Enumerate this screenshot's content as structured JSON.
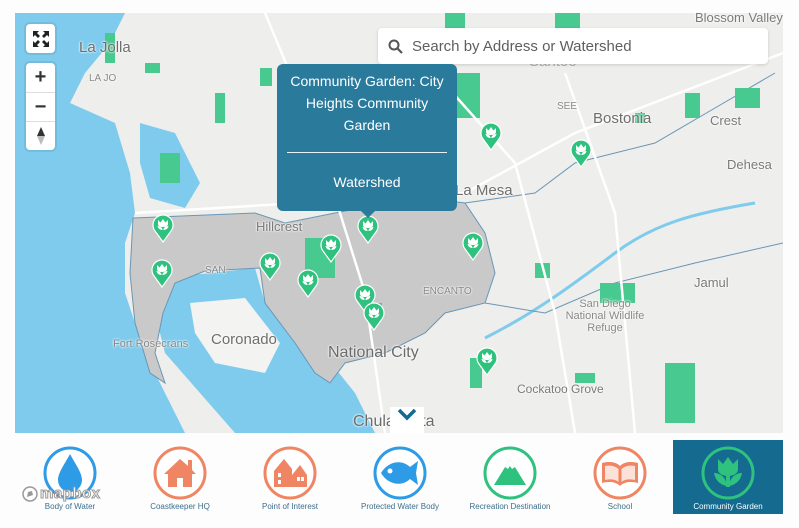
{
  "map": {
    "search": {
      "placeholder": "Search by Address or Watershed",
      "icon": "search-icon"
    },
    "controls": {
      "fullscreen_icon": "fullscreen-icon",
      "zoom_in": "+",
      "zoom_out": "−",
      "compass_icon": "compass-icon"
    },
    "places": {
      "la_jolla": "La Jolla",
      "la_jolla_small": "LA JO",
      "santee": "Santee",
      "see": "SEE",
      "bostonia": "Bostonia",
      "crest": "Crest",
      "dehesa": "Dehesa",
      "la_mesa": "La Mesa",
      "hillcrest": "Hillcrest",
      "san": "SAN",
      "encanto": "ENCANTO",
      "jamul": "Jamul",
      "sd_refuge": "San Diego National Wildlife Refuge",
      "fort_rosecrans": "Fort Rosecrans",
      "coronado": "Coronado",
      "national_city": "National City",
      "cockatoo_grove": "Cockatoo Grove",
      "chula_vista": "Chula Vista",
      "blossom_valley": "Blossom Valley"
    },
    "popup": {
      "title": "Community Garden: City Heights Community Garden",
      "link": "Watershed"
    },
    "collapse_icon": "chevron-down-icon",
    "attribution": "mapbox"
  },
  "legend": {
    "items": [
      {
        "label": "Body of Water",
        "icon": "water-drop-icon",
        "color": "#2e9be6",
        "active": false
      },
      {
        "label": "Coastkeeper HQ",
        "icon": "house-icon",
        "color": "#ef8562",
        "active": false
      },
      {
        "label": "Point of Interest",
        "icon": "buildings-icon",
        "color": "#ef8562",
        "active": false
      },
      {
        "label": "Protected Water Body",
        "icon": "fish-icon",
        "color": "#2e9be6",
        "active": false
      },
      {
        "label": "Recreation Destination",
        "icon": "mountain-icon",
        "color": "#2ec27e",
        "active": false
      },
      {
        "label": "School",
        "icon": "book-icon",
        "color": "#ef8562",
        "active": false
      },
      {
        "label": "Community Garden",
        "icon": "tulip-icon",
        "color": "#2ec27e",
        "active": true
      }
    ]
  },
  "colors": {
    "water": "#7fcbed",
    "watershed_fill": "#c9c9c9",
    "park_green": "#47c98f",
    "pin_green": "#2ec27e",
    "popup_bg": "#2a7a9c",
    "active_legend_bg": "#146a8f",
    "legend_text": "#3c6f8c"
  }
}
